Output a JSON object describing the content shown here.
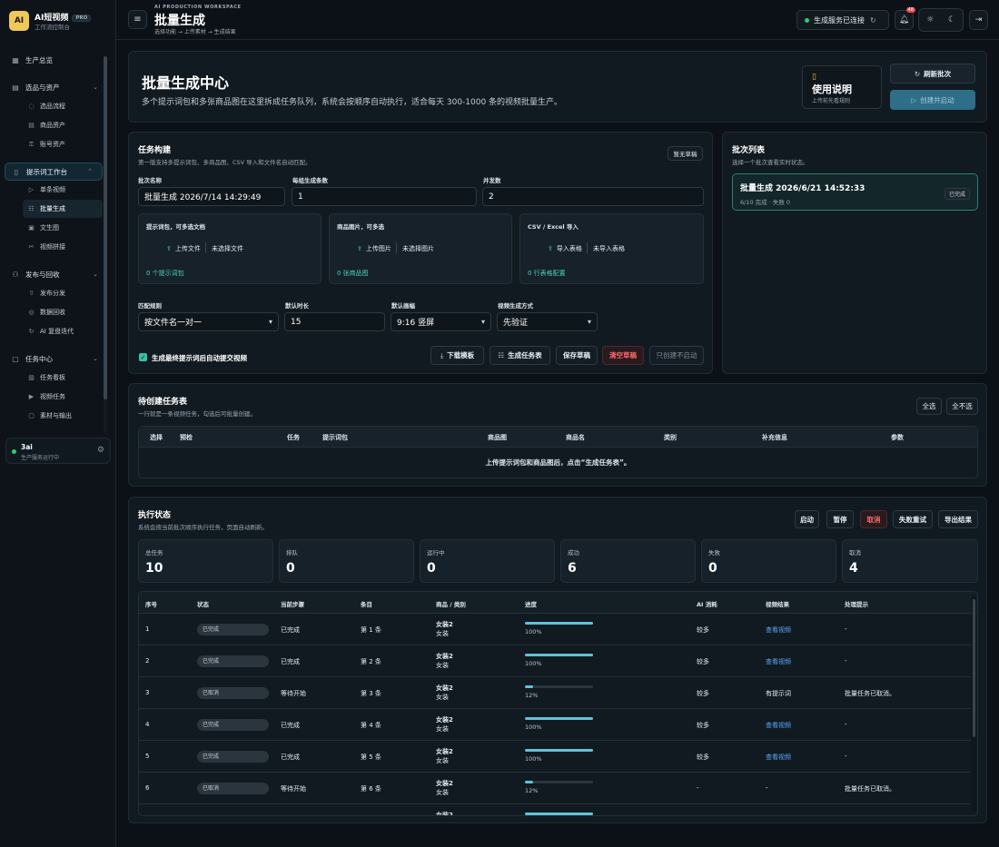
{
  "brand": {
    "logo": "AI",
    "name": "AI短视频",
    "badge": "PRO",
    "sub": "工作流控制台"
  },
  "nav": [
    {
      "type": "group",
      "icon": "▦",
      "label": "生产总览",
      "icon_name": "grid-icon"
    },
    {
      "type": "gap"
    },
    {
      "type": "group",
      "icon": "▤",
      "label": "选品与资产",
      "chev": "⌄",
      "icon_name": "database-icon"
    },
    {
      "type": "sub",
      "icon": "◌",
      "label": "选品流程",
      "icon_name": "flow-icon"
    },
    {
      "type": "sub",
      "icon": "▤",
      "label": "商品资产",
      "icon_name": "database-icon"
    },
    {
      "type": "sub",
      "icon": "⚿",
      "label": "账号资产",
      "icon_name": "key-icon"
    },
    {
      "type": "gap"
    },
    {
      "type": "group",
      "icon": "▯",
      "label": "提示词工作台",
      "chev": "⌃",
      "active": true,
      "icon_name": "document-icon"
    },
    {
      "type": "sub",
      "icon": "▷",
      "label": "单条视频",
      "icon_name": "play-icon"
    },
    {
      "type": "sub",
      "icon": "☷",
      "label": "批量生成",
      "active": true,
      "icon_name": "list-icon"
    },
    {
      "type": "sub",
      "icon": "▣",
      "label": "文生图",
      "icon_name": "image-icon"
    },
    {
      "type": "sub",
      "icon": "✂",
      "label": "视频拼接",
      "icon_name": "scissors-icon"
    },
    {
      "type": "gap"
    },
    {
      "type": "group",
      "icon": "⚇",
      "label": "发布与回收",
      "chev": "⌄",
      "icon_name": "share-icon"
    },
    {
      "type": "sub",
      "icon": "⇧",
      "label": "发布分发",
      "icon_name": "upload-icon"
    },
    {
      "type": "sub",
      "icon": "◎",
      "label": "数据回收",
      "icon_name": "data-icon"
    },
    {
      "type": "sub",
      "icon": "↻",
      "label": "AI 复盘迭代",
      "icon_name": "refresh-icon"
    },
    {
      "type": "gap"
    },
    {
      "type": "group",
      "icon": "▢",
      "label": "任务中心",
      "chev": "⌄",
      "icon_name": "clipboard-icon"
    },
    {
      "type": "sub",
      "icon": "▥",
      "label": "任务看板",
      "icon_name": "board-icon"
    },
    {
      "type": "sub",
      "icon": "▶",
      "label": "视频任务",
      "icon_name": "video-icon"
    },
    {
      "type": "sub",
      "icon": "▢",
      "label": "素材与输出",
      "icon_name": "folder-icon"
    }
  ],
  "user": {
    "name": "3ai",
    "status": "生产服务运行中"
  },
  "header": {
    "kicker": "AI PRODUCTION WORKSPACE",
    "title": "批量生成",
    "crumb": "选择功能 → 上传素材 → 生成结果",
    "service": "生成服务已连接",
    "bell_count": "48"
  },
  "hero": {
    "title": "批量生成中心",
    "desc": "多个提示词包和多张商品图在这里拆成任务队列，系统会按顺序自动执行，适合每天 300-1000 条的视频批量生产。",
    "guide_title": "使用说明",
    "guide_sub": "上传前先看规则",
    "refresh": "刷新批次",
    "create": "创建并启动"
  },
  "build": {
    "title": "任务构建",
    "sub": "第一版支持多提示词包、多商品图、CSV 导入和文件名自动匹配。",
    "draft_tag": "暂无草稿",
    "batch_name_label": "批次名称",
    "batch_name": "批量生成 2026/7/14 14:29:49",
    "per_group_label": "每组生成条数",
    "per_group": "1",
    "concurrency_label": "并发数",
    "concurrency": "2",
    "prompt_box": {
      "title": "提示词包，可多选文档",
      "action": "上传文件",
      "status": "未选择文件",
      "footer": "0 个提示词包"
    },
    "image_box": {
      "title": "商品图片，可多选",
      "action": "上传图片",
      "status": "未选择图片",
      "footer": "0 张商品图"
    },
    "csv_box": {
      "title": "CSV / Excel 导入",
      "action": "导入表格",
      "status": "未导入表格",
      "footer": "0 行表格配置"
    },
    "match_label": "匹配规则",
    "match": "按文件名一对一",
    "duration_label": "默认时长",
    "duration": "15",
    "ratio_label": "默认画幅",
    "ratio": "9:16 竖屏",
    "mode_label": "视频生成方式",
    "mode": "先验证",
    "auto_label": "生成最终提示词后自动提交视频",
    "btn_template": "下载模板",
    "btn_gen": "生成任务表",
    "btn_save": "保存草稿",
    "btn_clear": "清空草稿",
    "btn_only": "只创建不启动"
  },
  "batches": {
    "title": "批次列表",
    "sub": "选择一个批次查看实时状态。",
    "item_title": "批量生成 2026/6/21 14:52:33",
    "item_sub": "6/10 完成 · 失败 0",
    "item_tag": "已完成"
  },
  "pending": {
    "title": "待创建任务表",
    "sub": "一行就是一条视频任务，勾选后可批量创建。",
    "select_all": "全选",
    "select_none": "全不选",
    "headers": [
      "选择",
      "预检",
      "任务",
      "提示词包",
      "商品图",
      "商品名",
      "类别",
      "补充信息",
      "参数"
    ],
    "empty": "上传提示词包和商品图后，点击“生成任务表”。"
  },
  "exec": {
    "title": "执行状态",
    "sub": "系统会按当前批次顺序执行任务，页面自动刷新。",
    "btns": [
      "启动",
      "暂停",
      "取消",
      "失败重试",
      "导出结果"
    ],
    "stats": [
      {
        "label": "总任务",
        "value": "10"
      },
      {
        "label": "排队",
        "value": "0"
      },
      {
        "label": "运行中",
        "value": "0"
      },
      {
        "label": "成功",
        "value": "6"
      },
      {
        "label": "失败",
        "value": "0"
      },
      {
        "label": "取消",
        "value": "4"
      }
    ],
    "headers": [
      "序号",
      "状态",
      "当前步骤",
      "条目",
      "商品 / 类别",
      "进度",
      "AI 消耗",
      "视频结果",
      "处理提示"
    ],
    "rows": [
      {
        "no": "1",
        "status": "已完成",
        "step": "已完成",
        "item": "第 1 条",
        "product": "女装2",
        "cat": "女装",
        "pct": "100%",
        "progress": 1.0,
        "cost": "较多",
        "result": "查看视频",
        "link": true,
        "note": "-"
      },
      {
        "no": "2",
        "status": "已完成",
        "step": "已完成",
        "item": "第 2 条",
        "product": "女装2",
        "cat": "女装",
        "pct": "100%",
        "progress": 1.0,
        "cost": "较多",
        "result": "查看视频",
        "link": true,
        "note": "-"
      },
      {
        "no": "3",
        "status": "已取消",
        "step": "等待开始",
        "item": "第 3 条",
        "product": "女装2",
        "cat": "女装",
        "pct": "12%",
        "progress": 0.12,
        "cost": "较多",
        "result": "有提示词",
        "link": false,
        "note": "批量任务已取消。"
      },
      {
        "no": "4",
        "status": "已完成",
        "step": "已完成",
        "item": "第 4 条",
        "product": "女装2",
        "cat": "女装",
        "pct": "100%",
        "progress": 1.0,
        "cost": "较多",
        "result": "查看视频",
        "link": true,
        "note": "-"
      },
      {
        "no": "5",
        "status": "已完成",
        "step": "已完成",
        "item": "第 5 条",
        "product": "女装2",
        "cat": "女装",
        "pct": "100%",
        "progress": 1.0,
        "cost": "较多",
        "result": "查看视频",
        "link": true,
        "note": "-"
      },
      {
        "no": "6",
        "status": "已取消",
        "step": "等待开始",
        "item": "第 6 条",
        "product": "女装2",
        "cat": "女装",
        "pct": "12%",
        "progress": 0.12,
        "cost": "-",
        "result": "-",
        "link": false,
        "note": "批量任务已取消。"
      },
      {
        "no": "",
        "status": "",
        "step": "",
        "item": "",
        "product": "女装2",
        "cat": "",
        "pct": "",
        "progress": 1.0,
        "cost": "",
        "result": "",
        "link": false,
        "note": ""
      }
    ]
  }
}
